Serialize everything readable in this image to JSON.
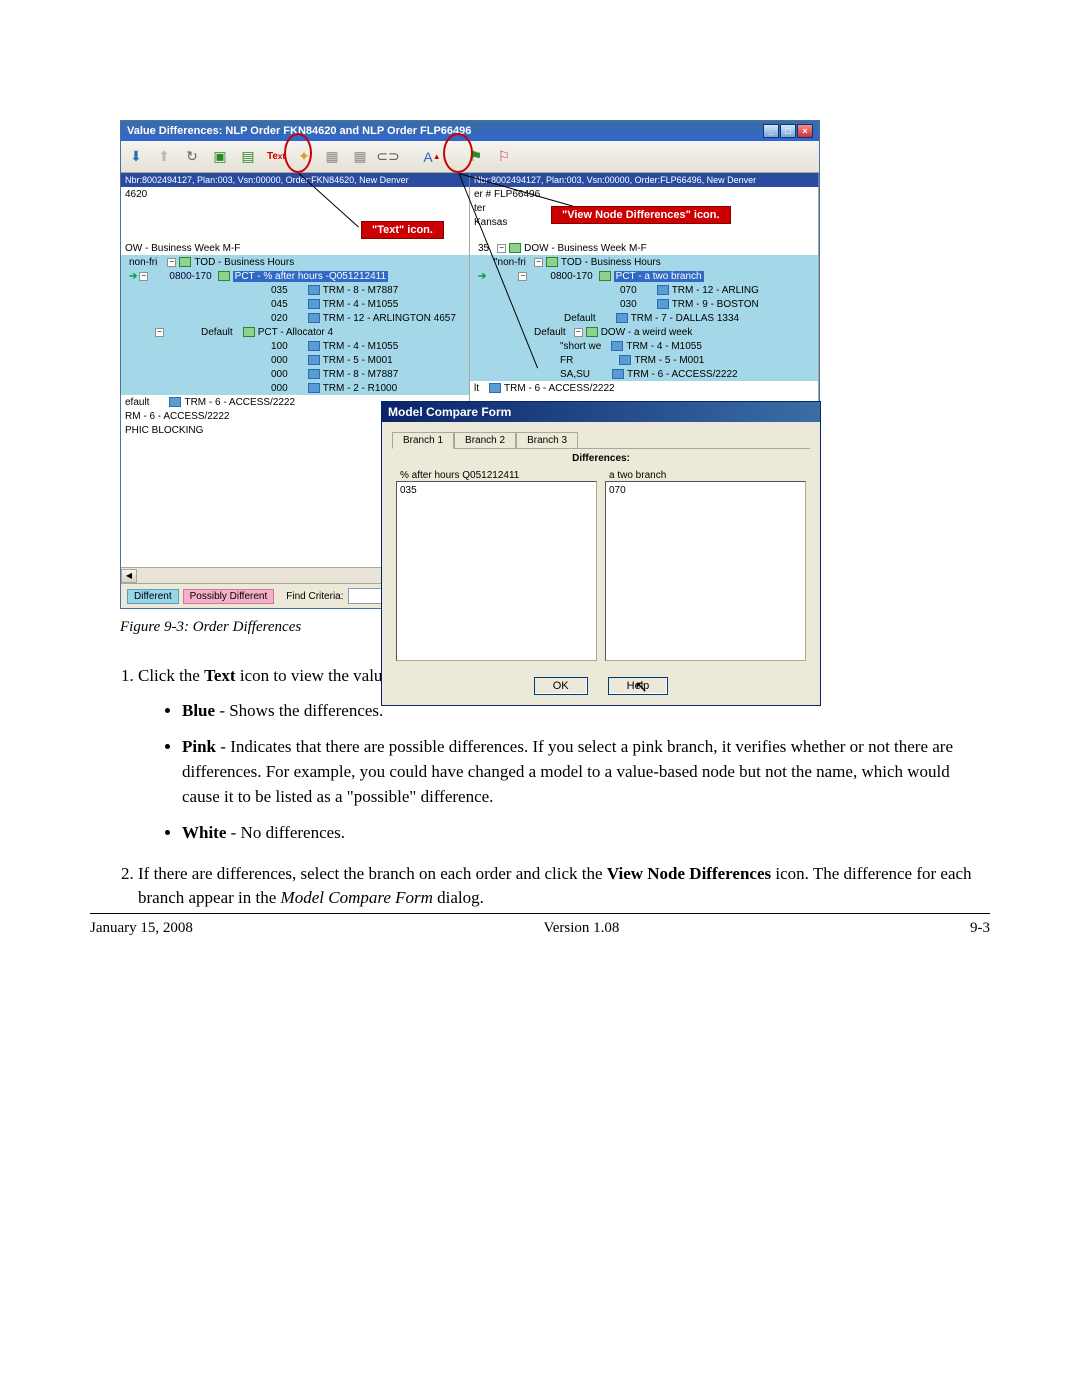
{
  "window": {
    "title": "Value Differences: NLP Order FKN84620 and NLP Order FLP66496",
    "breadcrumb_left": "Nbr:8002494127, Plan:003, Vsn:00000, Order:FKN84620, New Denver",
    "breadcrumb_right": "Nbr:8002494127, Plan:003, Vsn:00000, Order:FLP66496, New Denver"
  },
  "callouts": {
    "text_icon": "\"Text\" icon.",
    "view_diff": "\"View Node Differences\" icon."
  },
  "left_tree": {
    "r0": "4620",
    "r1": "OW - Business Week M-F",
    "r2": "non-fri",
    "r2b": "TOD - Business Hours",
    "r3": "0800-170",
    "r3b": "PCT - % after hours -Q051212411",
    "r4a_v": "035",
    "r4a_l": "TRM - 8 - M7887",
    "r4b_v": "045",
    "r4b_l": "TRM - 4 - M1055",
    "r4c_v": "020",
    "r4c_l": "TRM - 12 - ARLINGTON 4657",
    "r5": "Default",
    "r5b": "PCT - Allocator 4",
    "r6a_v": "100",
    "r6a_l": "TRM - 4 - M1055",
    "r6b_v": "000",
    "r6b_l": "TRM - 5 - M001",
    "r6c_v": "000",
    "r6c_l": "TRM - 8 - M7887",
    "r6d_v": "000",
    "r6d_l": "TRM - 2 - R1000",
    "r7": "efault",
    "r7b": "TRM - 6 - ACCESS/2222",
    "r8": "RM - 6 - ACCESS/2222",
    "r9": "PHIC BLOCKING"
  },
  "right_tree": {
    "r0": "er #  FLP66496",
    "r1": "ter",
    "r2": "Kansas",
    "r3": "35",
    "r3b": "DOW - Business Week M-F",
    "r4": "\"non-fri",
    "r4b": "TOD - Business Hours",
    "r5": "0800-170",
    "r5b": "PCT - a two branch",
    "r6a_v": "070",
    "r6a_l": "TRM - 12 - ARLING",
    "r6b_v": "030",
    "r6b_l": "TRM - 9 - BOSTON",
    "r6c_v": "Default",
    "r6c_l": "TRM - 7 - DALLAS 1334",
    "r7": "Default",
    "r7b": "DOW - a weird week",
    "r8a_v": "\"short we",
    "r8a_l": "TRM - 4 - M1055",
    "r8b_v": "FR",
    "r8b_l": "TRM - 5 - M001",
    "r8c_v": "SA,SU",
    "r8c_l": "TRM - 6 - ACCESS/2222",
    "r9": "lt",
    "r9b": "TRM - 6 - ACCESS/2222"
  },
  "legend": {
    "different": "Different",
    "possibly": "Possibly Different",
    "find": "Find Criteria:"
  },
  "dialog": {
    "title": "Model Compare Form",
    "tab1": "Branch 1",
    "tab2": "Branch 2",
    "tab3": "Branch 3",
    "diff_header": "Differences:",
    "left_label": "% after hours  Q051212411",
    "left_val": "035",
    "right_label": "a two branch",
    "right_val": "070",
    "ok": "OK",
    "help": "Help"
  },
  "caption": "Figure 9-3:   Order Differences",
  "instructions": {
    "s1_pre": "Click the ",
    "s1_b": "Text",
    "s1_post": " icon to view the values/labels on the plan branches.",
    "blue_b": "Blue",
    "blue_t": " - Shows the differences.",
    "pink_b": "Pink",
    "pink_t": " - Indicates that there are possible differences. If you select a pink branch, it verifies whether or not there are differences. For example, you could have changed a model to a value-based node but not the name, which would cause it to be listed as a \"possible\" difference.",
    "white_b": "White",
    "white_t": " - No differences.",
    "s2_pre": "If there are differences, select the branch on each order and click the ",
    "s2_b": "View Node Differences",
    "s2_post": " icon. The difference for each branch appear in the ",
    "s2_i": "Model Compare Form",
    "s2_end": " dialog."
  },
  "footer": {
    "date": "January 15, 2008",
    "version": "Version 1.08",
    "page": "9-3"
  },
  "glyphs": {
    "down": "⬇",
    "up": "⬆",
    "refresh": "↻",
    "tree1": "▣",
    "tree2": "▤",
    "text": "A",
    "star": "✦",
    "link": "⊂⊃",
    "diff": "Δ",
    "flag1": "⚑",
    "flag2": "⚐",
    "minus": "−",
    "plus": "+",
    "arrow": "➔",
    "min": "_",
    "max": "□",
    "close": "×",
    "left": "◀"
  }
}
